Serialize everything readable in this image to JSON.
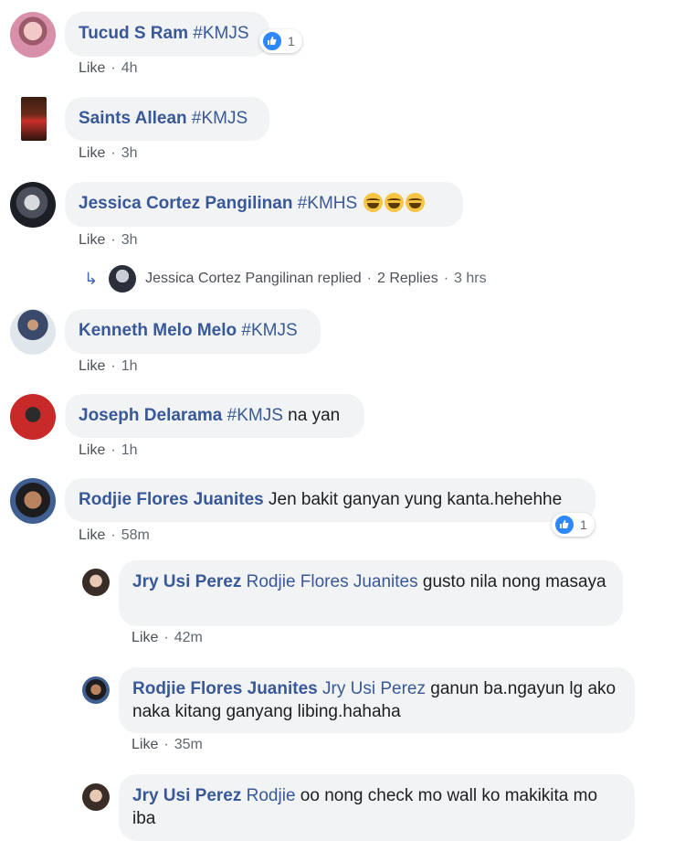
{
  "comments": [
    {
      "name": "Tucud S Ram",
      "text": "#KMJS",
      "like": "Like",
      "time": "4h",
      "reaction_count": "1"
    },
    {
      "name": "Saints Allean",
      "text": "#KMJS",
      "like": "Like",
      "time": "3h"
    },
    {
      "name": "Jessica Cortez Pangilinan",
      "text": "#KMHS",
      "like": "Like",
      "time": "3h"
    },
    {
      "name": "Kenneth Melo Melo",
      "text": "#KMJS",
      "like": "Like",
      "time": "1h"
    },
    {
      "name": "Joseph Delarama",
      "tag": "#KMJS",
      "text": " na yan",
      "like": "Like",
      "time": "1h"
    },
    {
      "name": "Rodjie Flores Juanites",
      "text": "Jen bakit ganyan yung kanta.hehehhe",
      "like": "Like",
      "time": "58m",
      "reaction_count": "1"
    }
  ],
  "replies_summary": {
    "name": "Jessica Cortez Pangilinan replied",
    "dot": "·",
    "replies": "2 Replies",
    "time": "3 hrs"
  },
  "replies": [
    {
      "name": "Jry Usi Perez",
      "mention": "Rodjie Flores Juanites",
      "text": " gusto nila nong masaya",
      "like": "Like",
      "time": "42m"
    },
    {
      "name": "Rodjie Flores Juanites",
      "mention": "Jry Usi Perez",
      "text": " ganun ba.ngayun lg ako naka kitang ganyang libing.hahaha",
      "like": "Like",
      "time": "35m"
    },
    {
      "name": "Jry Usi Perez",
      "mention": "Rodjie",
      "text": " oo nong check mo wall ko makikita mo iba"
    }
  ],
  "colors": {
    "link": "#385898",
    "bubble": "#f2f3f5",
    "reaction": "#2d88ff"
  }
}
